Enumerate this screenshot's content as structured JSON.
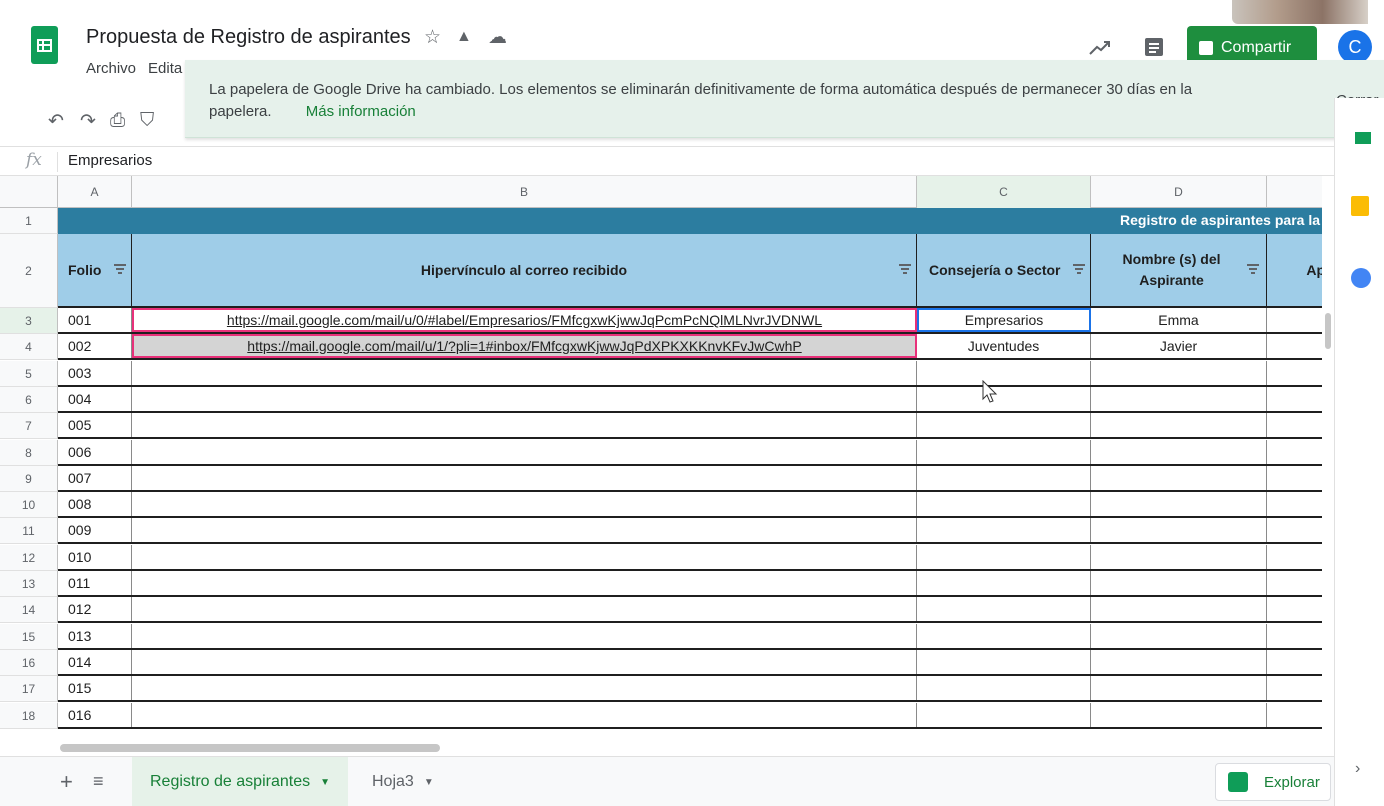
{
  "doc": {
    "title": "Propuesta de Registro de aspirantes",
    "menu": [
      "Archivo",
      "Edita"
    ]
  },
  "header": {
    "share_label": "Compartir",
    "avatar_initial": "C"
  },
  "notification": {
    "message": "La papelera de Google Drive ha cambiado. Los elementos se eliminarán definitivamente de forma automática después de permanecer 30 días en la papelera.",
    "more_label": "Más información",
    "close_label": "Cerrar"
  },
  "formula_bar": {
    "fx_label": "fx",
    "value": "Empresarios"
  },
  "grid": {
    "columns": [
      "A",
      "B",
      "C",
      "D"
    ],
    "title_band": "Registro de aspirantes para la",
    "headers": {
      "folio": "Folio",
      "link": "Hipervínculo al correo recibido",
      "sector": "Consejería o Sector",
      "name": "Nombre (s) del Aspirante",
      "next": "Ap"
    },
    "row_numbers": [
      "1",
      "2",
      "3",
      "4",
      "5",
      "6",
      "7",
      "8",
      "9",
      "10",
      "11",
      "12",
      "13",
      "14",
      "15",
      "16",
      "17",
      "18"
    ],
    "rows": [
      {
        "folio": "001",
        "link": "https://mail.google.com/mail/u/0/#label/Empresarios/FMfcgxwKjwwJqPcmPcNQlMLNvrJVDNWL",
        "sector": "Empresarios",
        "name": "Emma"
      },
      {
        "folio": "002",
        "link": "https://mail.google.com/mail/u/1/?pli=1#inbox/FMfcgxwKjwwJqPdXPKXKKnvKFvJwCwhP",
        "sector": "Juventudes",
        "name": "Javier"
      },
      {
        "folio": "003",
        "link": "",
        "sector": "",
        "name": ""
      },
      {
        "folio": "004",
        "link": "",
        "sector": "",
        "name": ""
      },
      {
        "folio": "005",
        "link": "",
        "sector": "",
        "name": ""
      },
      {
        "folio": "006",
        "link": "",
        "sector": "",
        "name": ""
      },
      {
        "folio": "007",
        "link": "",
        "sector": "",
        "name": ""
      },
      {
        "folio": "008",
        "link": "",
        "sector": "",
        "name": ""
      },
      {
        "folio": "009",
        "link": "",
        "sector": "",
        "name": ""
      },
      {
        "folio": "010",
        "link": "",
        "sector": "",
        "name": ""
      },
      {
        "folio": "011",
        "link": "",
        "sector": "",
        "name": ""
      },
      {
        "folio": "012",
        "link": "",
        "sector": "",
        "name": ""
      },
      {
        "folio": "013",
        "link": "",
        "sector": "",
        "name": ""
      },
      {
        "folio": "014",
        "link": "",
        "sector": "",
        "name": ""
      },
      {
        "folio": "015",
        "link": "",
        "sector": "",
        "name": ""
      },
      {
        "folio": "016",
        "link": "",
        "sector": "",
        "name": ""
      }
    ]
  },
  "sheets": {
    "tabs": [
      "Registro de aspirantes",
      "Hoja3"
    ],
    "active_index": 0,
    "explore_label": "Explorar"
  },
  "colors": {
    "title_band": "#2c7da0",
    "header_band": "#9fcde8",
    "share": "#1e8e3e",
    "notification_bg": "#e6f1eb",
    "link_highlight": "#e8317a",
    "selection": "#1a73e8"
  },
  "icons": [
    "undo-icon",
    "redo-icon",
    "print-icon",
    "paint-format-icon",
    "star-icon",
    "drive-move-icon",
    "cloud-status-icon",
    "trend-icon",
    "comment-icon",
    "keep-icon",
    "tasks-icon",
    "filter-icon",
    "cursor-icon"
  ]
}
